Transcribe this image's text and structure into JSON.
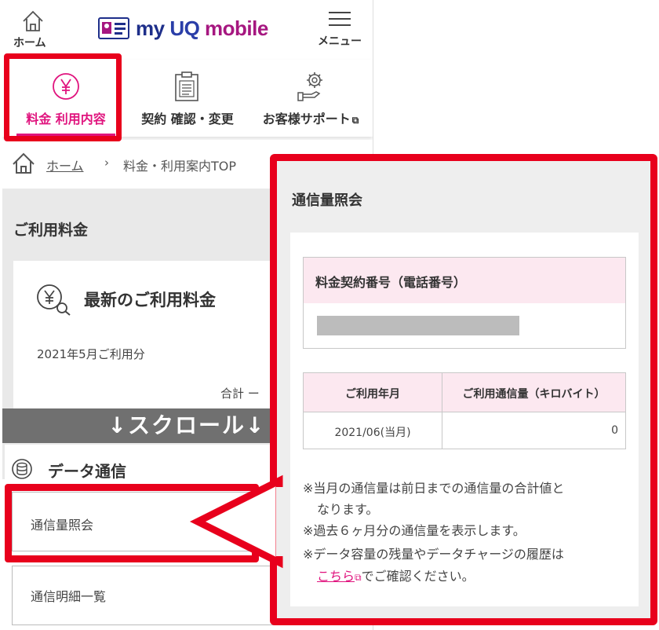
{
  "header": {
    "home_label": "ホーム",
    "logo_text_my": "my ",
    "logo_text_uq": "UQ",
    "logo_text_mobile": " mobile",
    "menu_label": "メニュー"
  },
  "nav": {
    "fee_label": "料金 利用内容",
    "contract_label": "契約 確認・変更",
    "support_label": "お客様サポート"
  },
  "breadcrumb": {
    "home": "ホーム",
    "separator": "›",
    "current": "料金・利用案内TOP"
  },
  "billing": {
    "section_title": "ご利用料金",
    "card_title": "最新のご利用料金",
    "month": "2021年5月ご利用分",
    "total_label": "合計 ー"
  },
  "scroll_banner": "↓スクロール↓",
  "data_section": {
    "title": "データ通信",
    "item1": "通信量照会",
    "item2": "通信明細一覧"
  },
  "panel": {
    "title": "通信量照会",
    "contract_number_header": "料金契約番号（電話番号）",
    "usage_table": {
      "col1": "ご利用年月",
      "col2": "ご利用通信量（キロバイト）",
      "rows": [
        {
          "month": "2021/06(当月)",
          "amount": "0"
        }
      ]
    },
    "notes": {
      "n1a": "※当月の通信量は前日までの通信量の合計値と",
      "n1b": "なります。",
      "n2": "※過去６ヶ月分の通信量を表示します。",
      "n3": "※データ容量の残量やデータチャージの履歴は",
      "n4_link": "こちら",
      "n4_rest": "でご確認ください。"
    }
  },
  "colors": {
    "accent": "#e0147e",
    "highlight": "#e8001c",
    "table_header": "#fce8f0"
  }
}
